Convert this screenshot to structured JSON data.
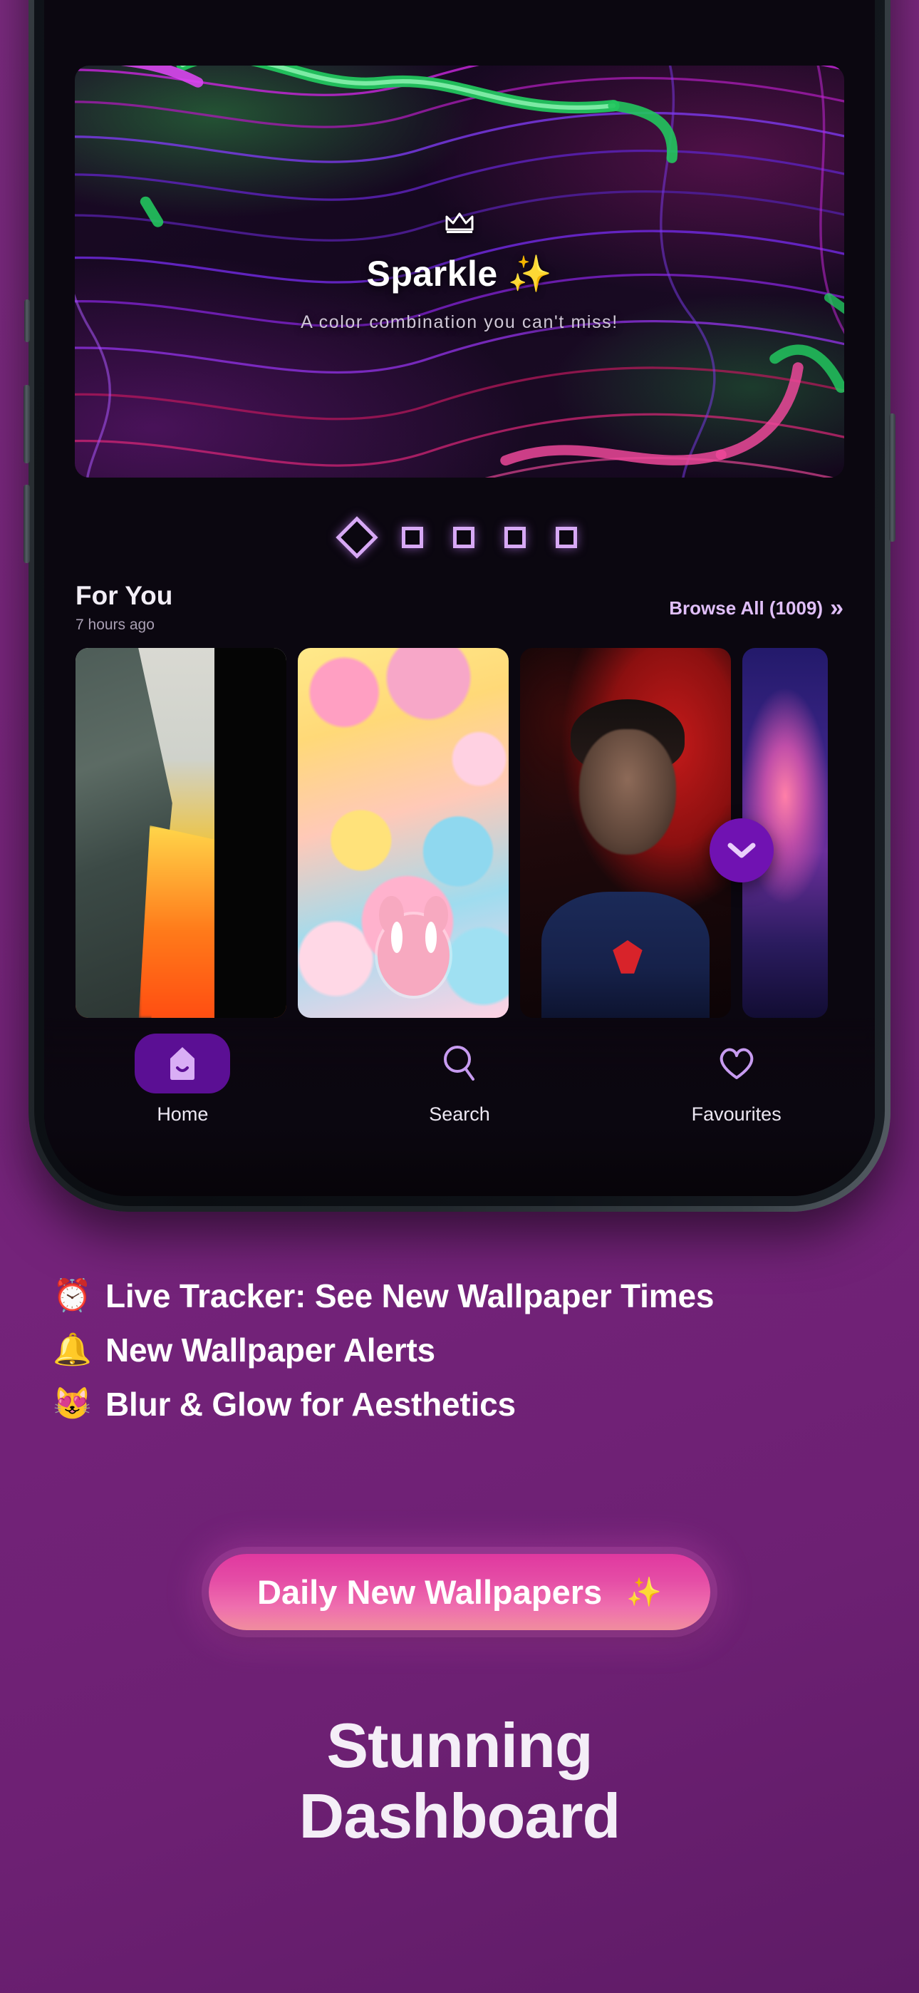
{
  "hero": {
    "crown_icon": "crown-icon",
    "title": "Sparkle",
    "title_sparkle": "✨",
    "subtitle": "A color combination you can't miss!"
  },
  "carousel": {
    "indicators": [
      {
        "shape": "diamond",
        "active": true
      },
      {
        "shape": "square",
        "active": false
      },
      {
        "shape": "square",
        "active": false
      },
      {
        "shape": "square",
        "active": false
      },
      {
        "shape": "square",
        "active": false
      }
    ]
  },
  "section": {
    "title": "For You",
    "timestamp": "7 hours ago",
    "browse_all_label": "Browse All (1009)",
    "browse_all_chevrons": "»",
    "count": 1009
  },
  "wallpapers": [
    {
      "name": "mountain-lake-sunset"
    },
    {
      "name": "kawaii-pastel-bears"
    },
    {
      "name": "superhero-red-portrait"
    },
    {
      "name": "purple-aurora-peaks"
    }
  ],
  "scroll_down": {
    "icon": "chevron-down-icon"
  },
  "bottom_nav": {
    "items": [
      {
        "label": "Home",
        "icon": "home-icon",
        "active": true
      },
      {
        "label": "Search",
        "icon": "search-icon",
        "active": false
      },
      {
        "label": "Favourites",
        "icon": "heart-icon",
        "active": false
      }
    ]
  },
  "features": [
    {
      "emoji": "⏰",
      "text": "Live Tracker: See New Wallpaper Times"
    },
    {
      "emoji": "🔔",
      "text": "New Wallpaper Alerts"
    },
    {
      "emoji": "😻",
      "text": "Blur & Glow for Aesthetics"
    }
  ],
  "cta": {
    "label": "Daily New Wallpapers",
    "sparkle": "✨"
  },
  "headline": {
    "line1": "Stunning",
    "line2": "Dashboard"
  },
  "colors": {
    "background_purple": "#79267d",
    "accent_purple": "#7012b2",
    "nav_active": "#5b0f94",
    "lilac": "#d7a9f5",
    "cta_pink": "#e0389f",
    "cta_peach": "#f08d9e"
  }
}
